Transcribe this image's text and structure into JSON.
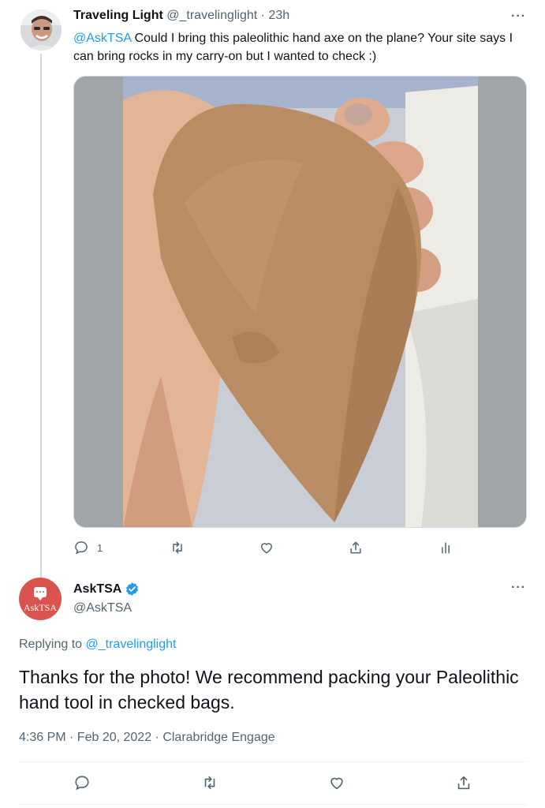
{
  "tweet1": {
    "author_name": "Traveling Light",
    "author_handle": "@_travelinglight",
    "separator": "·",
    "time": "23h",
    "mention": "@AskTSA",
    "text": " Could I bring this paleolithic hand axe on the plane? Your site says I can bring rocks in my carry-on but I wanted to check :)",
    "more": "···",
    "actions": {
      "reply_count": "1",
      "icons": [
        "reply-icon",
        "retweet-icon",
        "like-icon",
        "share-icon",
        "analytics-icon"
      ]
    }
  },
  "tweet2": {
    "author_name": "AskTSA",
    "author_handle": "@AskTSA",
    "avatar_text": "AskTSA",
    "more": "···",
    "replying_prefix": "Replying to ",
    "replying_handle": "@_travelinglight",
    "text": "Thanks for the photo! We recommend packing your Paleolithic hand tool in checked bags.",
    "meta": "4:36 PM · Feb 20, 2022 · Clarabridge Engage",
    "actions": {
      "icons": [
        "reply-icon",
        "retweet-icon",
        "like-icon",
        "share-icon"
      ]
    }
  },
  "colors": {
    "link": "#1d9bf0",
    "secondary_text": "#536471",
    "primary_text": "#0f1419",
    "asktsa_brand": "#d9534f"
  }
}
